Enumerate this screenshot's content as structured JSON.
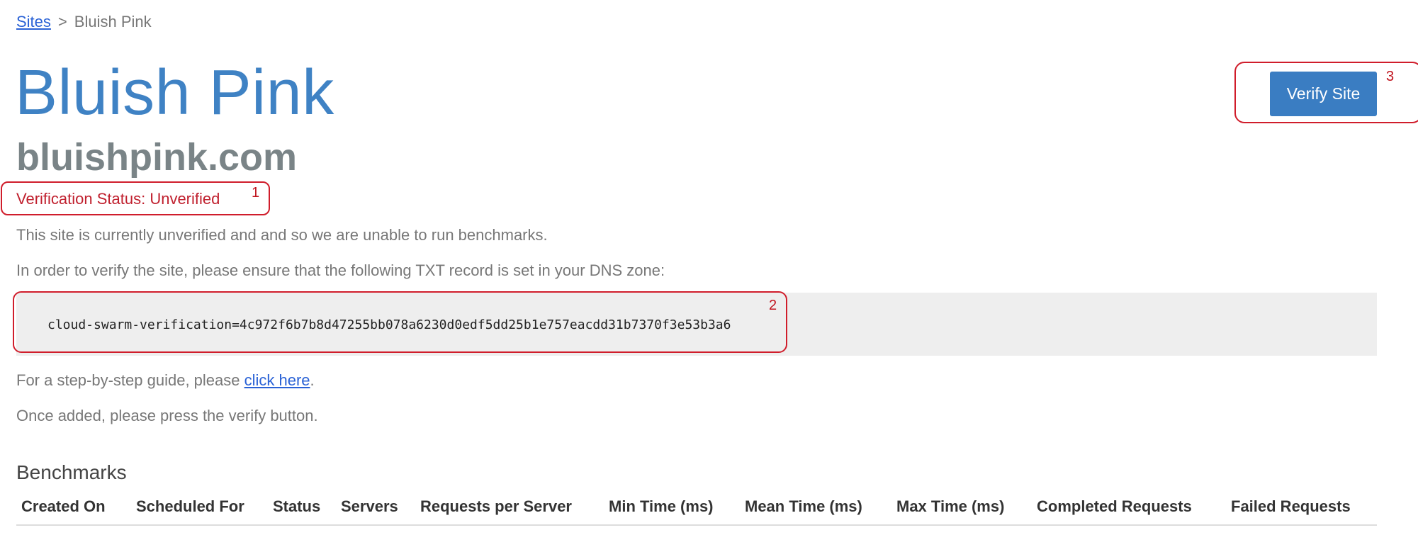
{
  "breadcrumb": {
    "sites_link": "Sites",
    "separator": ">",
    "current": "Bluish Pink"
  },
  "site": {
    "title": "Bluish Pink",
    "domain": "bluishpink.com"
  },
  "verify_button": {
    "label": "Verify Site"
  },
  "verification": {
    "status_text": "Verification Status: Unverified",
    "unverified_message": "This site is currently unverified and and so we are unable to run benchmarks.",
    "instructions": "In order to verify the site, please ensure that the following TXT record is set in your DNS zone:",
    "txt_record": "cloud-swarm-verification=4c972f6b7b8d47255bb078a6230d0edf5dd25b1e757eacdd31b7370f3e53b3a6",
    "guide_prefix": "For a step-by-step guide, please ",
    "guide_link": "click here",
    "guide_suffix": ".",
    "press_verify": "Once added, please press the verify button."
  },
  "annotations": {
    "marker_1": "1",
    "marker_2": "2",
    "marker_3": "3",
    "color": "#d01d2b"
  },
  "benchmarks": {
    "title": "Benchmarks",
    "columns": [
      "Created On",
      "Scheduled For",
      "Status",
      "Servers",
      "Requests per Server",
      "Min Time (ms)",
      "Mean Time (ms)",
      "Max Time (ms)",
      "Completed Requests",
      "Failed Requests"
    ]
  },
  "colors": {
    "title_blue": "#3f82c4",
    "button_blue": "#3a7dc2",
    "link_blue": "#2a62d6",
    "status_red": "#c0202e",
    "code_bg": "#eeeeee"
  }
}
